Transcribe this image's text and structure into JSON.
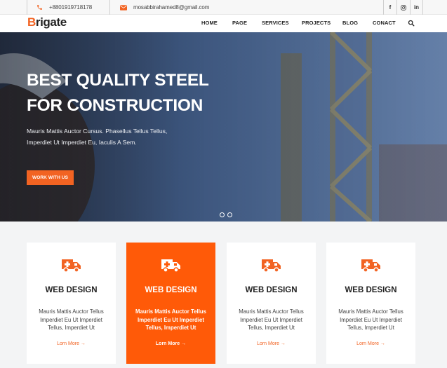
{
  "topbar": {
    "phone": "+8801919718178",
    "email": "mosabbirahamed8@gmail.com",
    "social": [
      "f",
      "ig",
      "in"
    ]
  },
  "nav": {
    "logo_first": "B",
    "logo_rest": "rigate",
    "items": [
      "HOME",
      "PAGE",
      "SERVICES",
      "PROJECTS",
      "BLOG",
      "CONACT"
    ]
  },
  "hero": {
    "title": "BEST QUALITY STEEL FOR CONSTRUCTION",
    "text": "Mauris Mattis Auctor Cursus. Phasellus Tellus Tellus, Imperdiet Ut Imperdiet Eu, Iaculis A Sem.",
    "button": "WORK WITH US"
  },
  "cards": [
    {
      "title": "WEB DESIGN",
      "text": "Mauris Mattis Auctor Tellus Imperdiet Eu Ut Imperdiet Tellus, Imperdiet Ut",
      "link": "Lorn More"
    },
    {
      "title": "WEB DESIGN",
      "text": "Mauris Mattis Auctor Tellus Imperdiet Eu Ut Imperdiet Tellus, Imperdiet Ut",
      "link": "Lorn More"
    },
    {
      "title": "WEB DESIGN",
      "text": "Mauris Mattis Auctor Tellus Imperdiet Eu Ut Imperdiet Tellus, Imperdiet Ut",
      "link": "Lorn More"
    },
    {
      "title": "WEB DESIGN",
      "text": "Mauris Mattis Auctor Tellus Imperdiet Eu Ut Imperdiet Tellus, Imperdiet Ut",
      "link": "Lorn More"
    }
  ],
  "colors": {
    "accent": "#f26322",
    "active_card": "#ff5a08"
  },
  "icons": [
    "phone-icon",
    "mail-icon",
    "facebook-icon",
    "instagram-icon",
    "linkedin-icon",
    "search-icon",
    "ambulance-icon",
    "arrow-right-icon"
  ]
}
